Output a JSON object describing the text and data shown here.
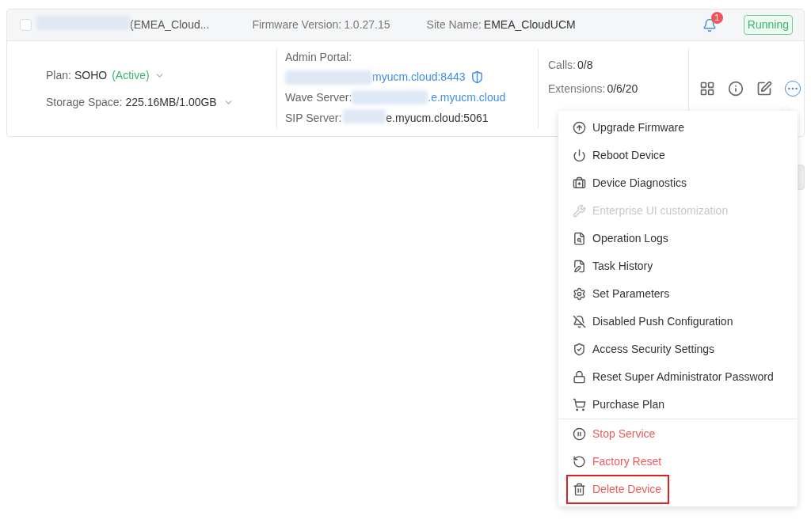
{
  "device": {
    "checked": false,
    "name": "(EMEA_Cloud...",
    "firmware_label": "Firmware Version:",
    "firmware": "1.0.27.15",
    "site_label": "Site Name:",
    "site": "EMEA_CloudUCM",
    "alerts": "1",
    "status": "Running"
  },
  "plan": {
    "label": "Plan:",
    "value": "SOHO",
    "state": "(Active)"
  },
  "storage": {
    "label": "Storage Space:",
    "value": "225.16MB/1.00GB"
  },
  "servers": {
    "admin_label": "Admin Portal:",
    "admin": "myucm.cloud:8443",
    "wave_label": "Wave Server:",
    "wave": ".e.myucm.cloud",
    "sip_label": "SIP Server:",
    "sip": "e.myucm.cloud:5061"
  },
  "stats": [
    {
      "label": "Calls:",
      "value": "0/8"
    },
    {
      "label": "Extensions:",
      "value": "0/6/20"
    }
  ],
  "menu": [
    {
      "label": "Upgrade Firmware",
      "kind": "normal",
      "highlighted": false
    },
    {
      "label": "Reboot Device",
      "kind": "normal",
      "highlighted": false
    },
    {
      "label": "Device Diagnostics",
      "kind": "normal",
      "highlighted": false
    },
    {
      "label": "Enterprise UI customization",
      "kind": "disabled",
      "highlighted": false
    },
    {
      "label": "Operation Logs",
      "kind": "normal",
      "highlighted": false
    },
    {
      "label": "Task History",
      "kind": "normal",
      "highlighted": false
    },
    {
      "label": "Set Parameters",
      "kind": "normal",
      "highlighted": false
    },
    {
      "label": "Disabled Push Configuration",
      "kind": "normal",
      "highlighted": false
    },
    {
      "label": "Access Security Settings",
      "kind": "normal",
      "highlighted": false
    },
    {
      "label": "Reset Super Administrator Password",
      "kind": "normal",
      "highlighted": false
    },
    {
      "label": "Purchase Plan",
      "kind": "normal",
      "highlighted": false
    },
    {
      "label": "Stop Service",
      "kind": "danger",
      "highlighted": false
    },
    {
      "label": "Factory Reset",
      "kind": "danger",
      "highlighted": false
    },
    {
      "label": "Delete Device",
      "kind": "danger",
      "highlighted": true
    }
  ]
}
